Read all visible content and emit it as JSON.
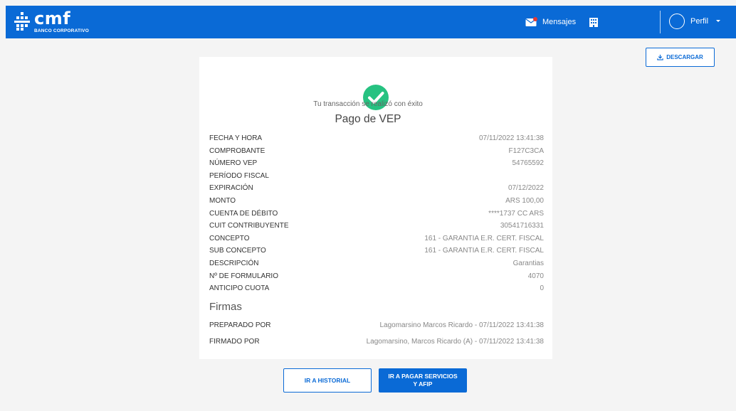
{
  "header": {
    "logo_text": "cmf",
    "logo_subtitle": "BANCO CORPORATIVO",
    "messages_label": "Mensajes",
    "profile_label": "Perfil",
    "brand_color": "#0a6ad6"
  },
  "toolbar": {
    "download_label": "DESCARGAR"
  },
  "receipt": {
    "success_message": "Tu transacción se realizó con éxito",
    "title": "Pago de VEP",
    "rows": [
      {
        "label": "FECHA Y HORA",
        "value": "07/11/2022 13:41:38"
      },
      {
        "label": "COMPROBANTE",
        "value": "F127C3CA"
      },
      {
        "label": "NÚMERO VEP",
        "value": "54765592"
      },
      {
        "label": "PERÍODO FISCAL",
        "value": ""
      },
      {
        "label": "EXPIRACIÓN",
        "value": "07/12/2022"
      },
      {
        "label": "MONTO",
        "value": "ARS 100,00"
      },
      {
        "label": "CUENTA DE DÉBITO",
        "value": "****1737 CC ARS"
      },
      {
        "label": "CUIT CONTRIBUYENTE",
        "value": "30541716331"
      },
      {
        "label": "CONCEPTO",
        "value": "161 - GARANTIA E.R. CERT. FISCAL"
      },
      {
        "label": "SUB CONCEPTO",
        "value": "161 - GARANTIA E.R. CERT. FISCAL"
      },
      {
        "label": "DESCRIPCIÓN",
        "value": "Garantias"
      },
      {
        "label": "Nº DE FORMULARIO",
        "value": "4070"
      },
      {
        "label": "ANTICIPO CUOTA",
        "value": "0"
      }
    ],
    "signatures_title": "Firmas",
    "signatures": [
      {
        "label": "PREPARADO POR",
        "value": "Lagomarsino Marcos Ricardo - 07/11/2022 13:41:38"
      },
      {
        "label": "FIRMADO POR",
        "value": "Lagomarsino, Marcos Ricardo (A) - 07/11/2022 13:41:38"
      }
    ]
  },
  "actions": {
    "history_label": "IR A HISTORIAL",
    "pay_label": "IR A PAGAR SERVICIOS Y AFIP"
  }
}
